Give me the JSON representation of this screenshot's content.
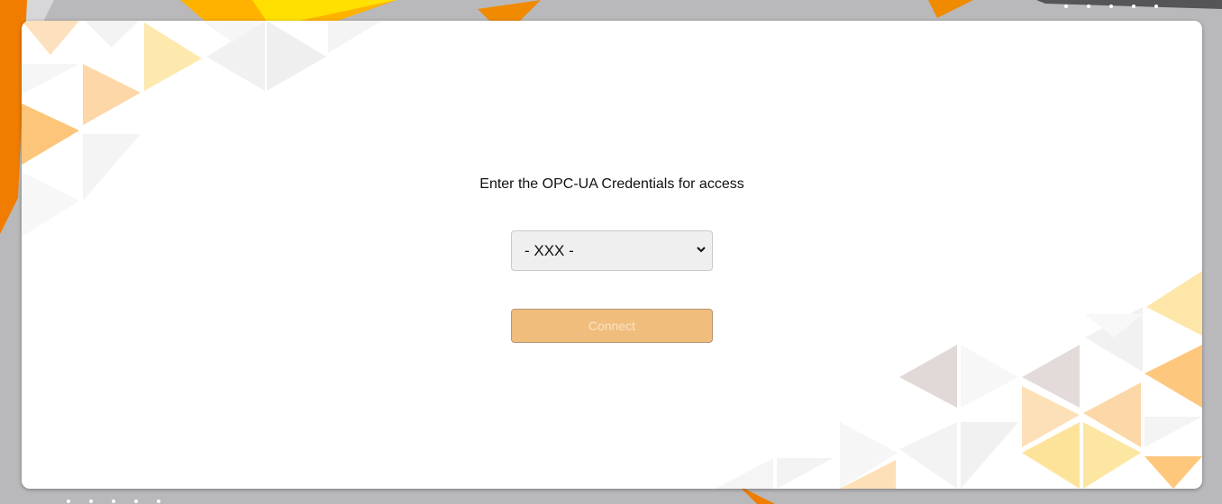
{
  "form": {
    "prompt": "Enter the OPC-UA Credentials for access",
    "credential_select": {
      "selected": "- XXX -",
      "options": [
        "- XXX -"
      ]
    },
    "connect_label": "Connect",
    "connect_disabled": true
  },
  "colors": {
    "background": "#b9b9bb",
    "card": "#ffffff",
    "accent_orange": "#f08a00",
    "accent_yellow": "#ffd000",
    "button": "#f0bd7d",
    "button_text": "#f9e4c6"
  },
  "icons": [
    "chevron-down-icon"
  ]
}
